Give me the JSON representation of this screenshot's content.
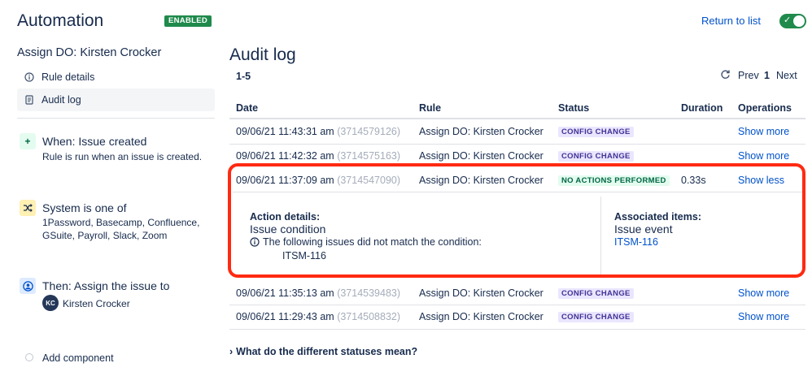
{
  "header": {
    "title": "Automation",
    "status_badge": "ENABLED",
    "return_link": "Return to list",
    "toggle_on": true,
    "accent": "#1f8a4c"
  },
  "sidebar": {
    "rule_title": "Assign DO: Kirsten Crocker",
    "nav": [
      {
        "label": "Rule details",
        "icon": "info-icon"
      },
      {
        "label": "Audit log",
        "icon": "document-icon",
        "active": true
      }
    ],
    "components": [
      {
        "icon": "plus-icon",
        "title": "When: Issue created",
        "description": "Rule is run when an issue is created.",
        "icon_color": "#e3fcef"
      },
      {
        "icon": "shuffle-icon",
        "title": "System is one of",
        "description": "1Password, Basecamp, Confluence, GSuite, Payroll, Slack, Zoom",
        "icon_color": "#fff0b3"
      },
      {
        "icon": "user-circle-icon",
        "title": "Then: Assign the issue to",
        "assignee_initials": "KC",
        "assignee_name": "Kirsten Crocker",
        "icon_color": "#deebff"
      }
    ],
    "add_component": "Add component"
  },
  "main": {
    "title": "Audit log",
    "range": "1-5",
    "pager": {
      "prev": "Prev",
      "page": "1",
      "next": "Next"
    },
    "columns": [
      "Date",
      "Rule",
      "Status",
      "Duration",
      "Operations"
    ],
    "rows": [
      {
        "date": "09/06/21 11:43:31 am",
        "id": "(3714579126)",
        "rule": "Assign DO: Kirsten Crocker",
        "status": "CONFIG CHANGE",
        "duration": "",
        "operation": "Show more"
      },
      {
        "date": "09/06/21 11:42:32 am",
        "id": "(3714575163)",
        "rule": "Assign DO: Kirsten Crocker",
        "status": "CONFIG CHANGE",
        "duration": "",
        "operation": "Show more"
      },
      {
        "date": "09/06/21 11:37:09 am",
        "id": "(3714547090)",
        "rule": "Assign DO: Kirsten Crocker",
        "status": "NO ACTIONS PERFORMED",
        "duration": "0.33s",
        "operation": "Show less"
      },
      {
        "date": "09/06/21 11:35:13 am",
        "id": "(3714539483)",
        "rule": "Assign DO: Kirsten Crocker",
        "status": "CONFIG CHANGE",
        "duration": "",
        "operation": "Show more"
      },
      {
        "date": "09/06/21 11:29:43 am",
        "id": "(3714508832)",
        "rule": "Assign DO: Kirsten Crocker",
        "status": "CONFIG CHANGE",
        "duration": "",
        "operation": "Show more"
      }
    ],
    "details": {
      "action_heading": "Action details:",
      "action_title": "Issue condition",
      "action_message": "The following issues did not match the condition:",
      "action_issue": "ITSM-116",
      "assoc_heading": "Associated items:",
      "assoc_title": "Issue event",
      "assoc_issue": "ITSM-116"
    },
    "faq": "What do the different statuses mean?"
  }
}
